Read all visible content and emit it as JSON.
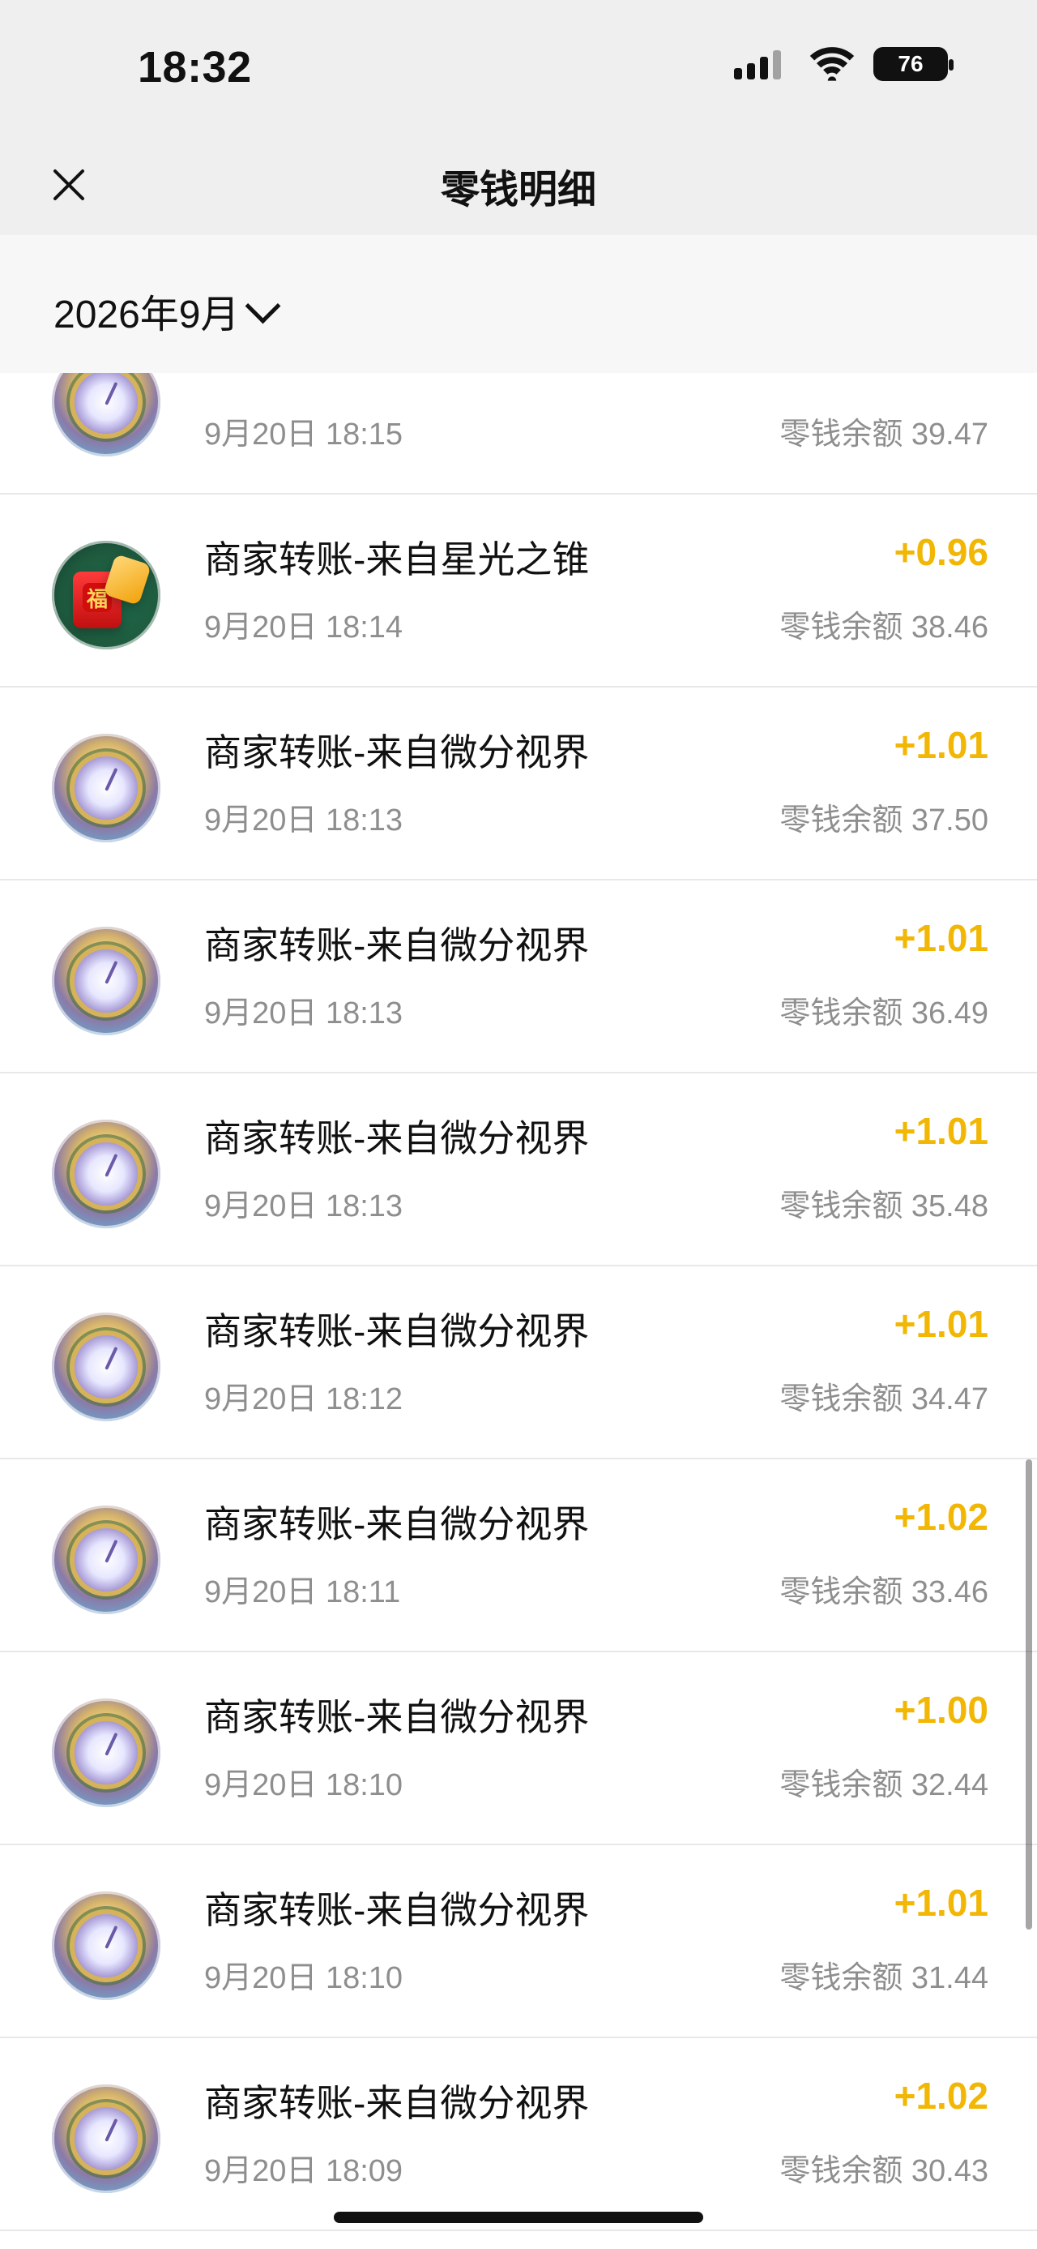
{
  "status_bar": {
    "time": "18:32",
    "battery": "76",
    "icons": {
      "signal": "signal-icon",
      "wifi": "wifi-icon",
      "battery": "battery-icon"
    }
  },
  "header": {
    "title": "零钱明细",
    "close_icon": "close-icon"
  },
  "filter": {
    "month_label": "2026年9月",
    "chevron_icon": "chevron-down-icon"
  },
  "transactions": [
    {
      "title": "",
      "time": "9月20日 18:15",
      "amount": "",
      "balance": "零钱余额 39.47",
      "avatar": "game-avatar"
    },
    {
      "title": "商家转账-来自星光之锥",
      "time": "9月20日 18:14",
      "amount": "+0.96",
      "balance": "零钱余额 38.46",
      "avatar": "red-packet-avatar"
    },
    {
      "title": "商家转账-来自微分视界",
      "time": "9月20日 18:13",
      "amount": "+1.01",
      "balance": "零钱余额 37.50",
      "avatar": "game-avatar"
    },
    {
      "title": "商家转账-来自微分视界",
      "time": "9月20日 18:13",
      "amount": "+1.01",
      "balance": "零钱余额 36.49",
      "avatar": "game-avatar"
    },
    {
      "title": "商家转账-来自微分视界",
      "time": "9月20日 18:13",
      "amount": "+1.01",
      "balance": "零钱余额 35.48",
      "avatar": "game-avatar"
    },
    {
      "title": "商家转账-来自微分视界",
      "time": "9月20日 18:12",
      "amount": "+1.01",
      "balance": "零钱余额 34.47",
      "avatar": "game-avatar"
    },
    {
      "title": "商家转账-来自微分视界",
      "time": "9月20日 18:11",
      "amount": "+1.02",
      "balance": "零钱余额 33.46",
      "avatar": "game-avatar"
    },
    {
      "title": "商家转账-来自微分视界",
      "time": "9月20日 18:10",
      "amount": "+1.00",
      "balance": "零钱余额 32.44",
      "avatar": "game-avatar"
    },
    {
      "title": "商家转账-来自微分视界",
      "time": "9月20日 18:10",
      "amount": "+1.01",
      "balance": "零钱余额 31.44",
      "avatar": "game-avatar"
    },
    {
      "title": "商家转账-来自微分视界",
      "time": "9月20日 18:09",
      "amount": "+1.02",
      "balance": "零钱余额 30.43",
      "avatar": "game-avatar"
    }
  ],
  "colors": {
    "amount": "#f2b705",
    "subtext": "#8e8e8e",
    "top_background": "#efefef"
  }
}
